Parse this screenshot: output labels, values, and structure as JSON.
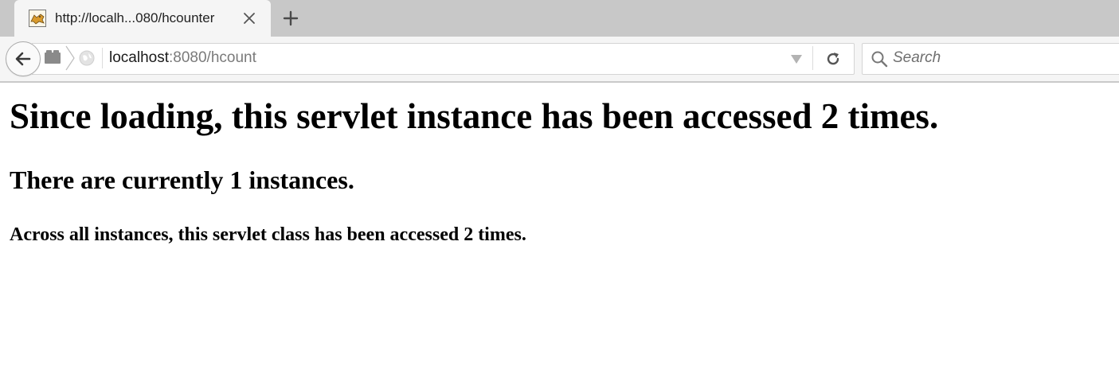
{
  "browser": {
    "tab": {
      "title": "http://localh...080/hcounter",
      "favicon": "tomcat-icon"
    },
    "address_bar": {
      "host": "localhost",
      "rest": ":8080/hcount"
    },
    "search": {
      "placeholder": "Search"
    },
    "icons": {
      "back": "back-arrow-icon",
      "identity": "identity-block-icon",
      "globe": "globe-icon",
      "dropdown": "dropdown-marker-icon",
      "reload": "reload-icon",
      "search": "search-icon",
      "close_tab": "close-icon",
      "new_tab": "plus-icon"
    }
  },
  "page": {
    "heading1": "Since loading, this servlet instance has been accessed 2 times.",
    "heading2": "There are currently 1 instances.",
    "heading3": "Across all instances, this servlet class has been accessed 2 times."
  }
}
